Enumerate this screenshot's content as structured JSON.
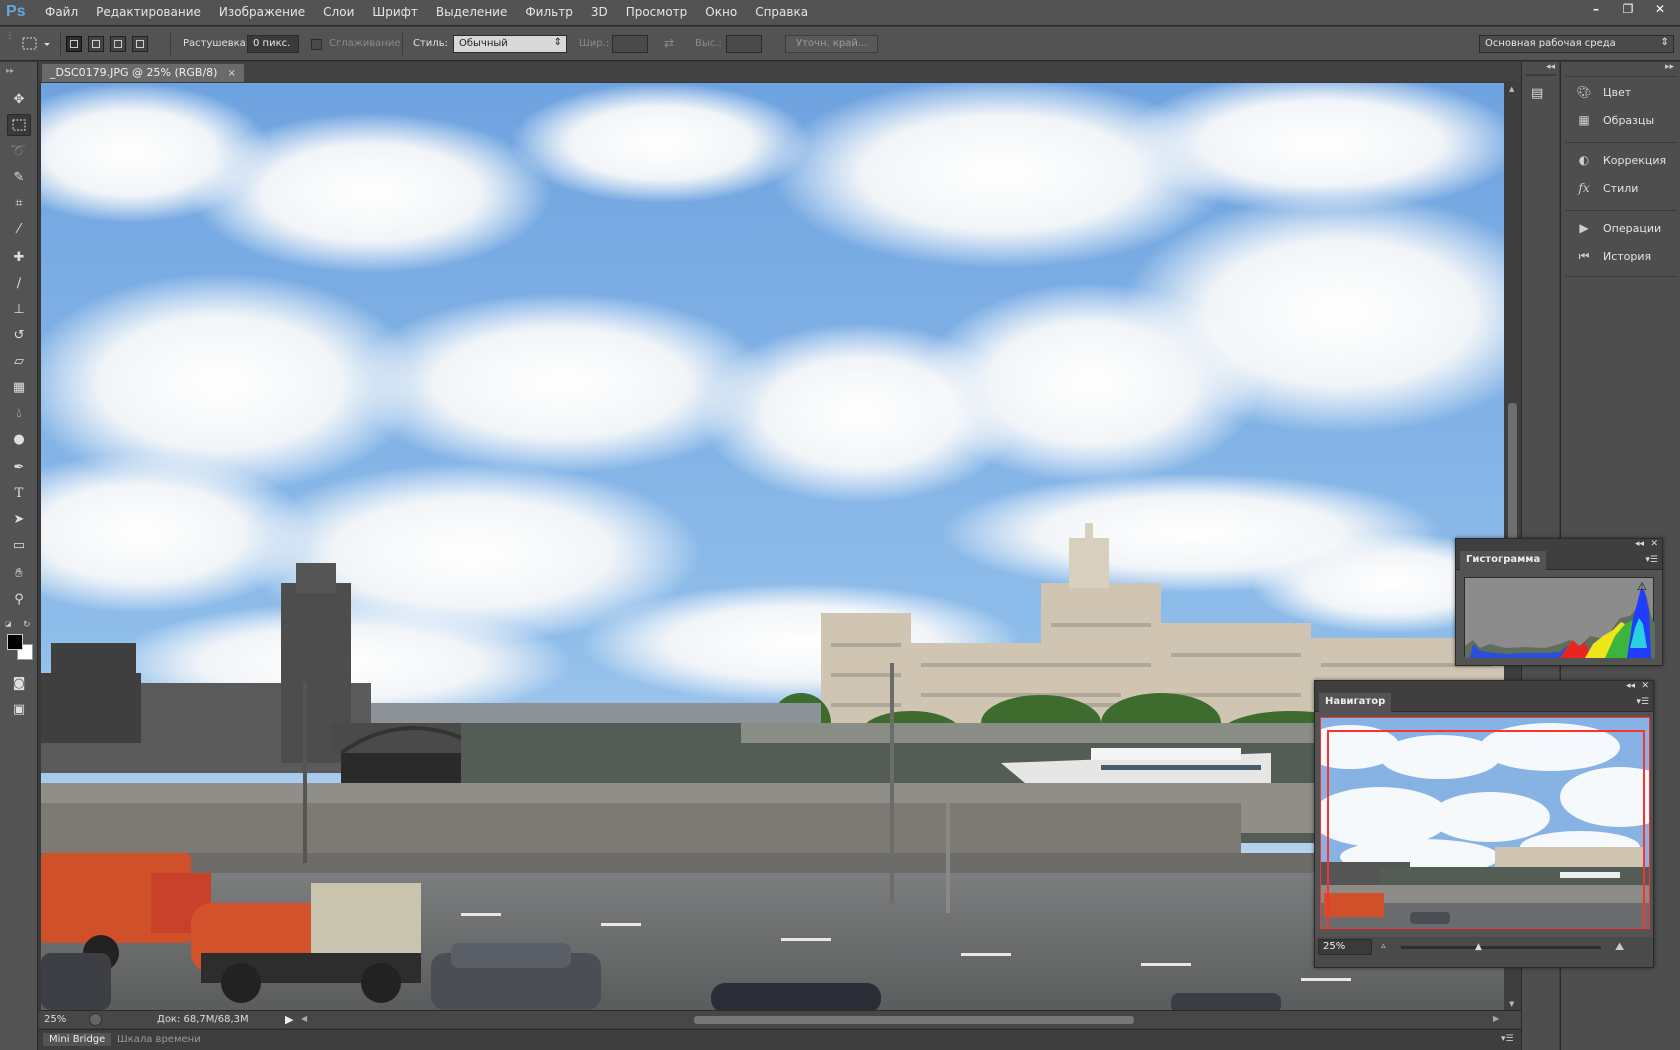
{
  "app": {
    "logo": "Ps"
  },
  "menu": [
    "Файл",
    "Редактирование",
    "Изображение",
    "Слои",
    "Шрифт",
    "Выделение",
    "Фильтр",
    "3D",
    "Просмотр",
    "Окно",
    "Справка"
  ],
  "window_controls": {
    "minimize": "–",
    "restore": "❐",
    "close": "✕"
  },
  "options": {
    "feather_label": "Растушевка:",
    "feather_value": "0 пикс.",
    "antialias_label": "Сглаживание",
    "style_label": "Стиль:",
    "style_value": "Обычный",
    "width_label": "Шир.:",
    "height_label": "Выс.:",
    "refine_edge": "Уточн. край...",
    "workspace": "Основная рабочая среда"
  },
  "document": {
    "tab_title": "_DSC0179.JPG @ 25% (RGB/8)",
    "close": "×",
    "zoom": "25%",
    "doc_info": "Док: 68,7M/68,3M"
  },
  "bottom_tabs": [
    "Mini Bridge",
    "Шкала времени"
  ],
  "dock": {
    "groups": [
      [
        {
          "label": "Цвет",
          "icon": "palette-icon"
        },
        {
          "label": "Образцы",
          "icon": "swatches-icon"
        }
      ],
      [
        {
          "label": "Коррекция",
          "icon": "adjustments-icon"
        },
        {
          "label": "Стили",
          "icon": "fx-styles-icon"
        }
      ],
      [
        {
          "label": "Операции",
          "icon": "play-actions-icon"
        },
        {
          "label": "История",
          "icon": "history-icon"
        }
      ]
    ]
  },
  "histogram": {
    "title": "Гистограмма"
  },
  "navigator": {
    "title": "Навигатор",
    "zoom": "25%"
  },
  "colors": {
    "ps_blue": "#5fa8e0",
    "panel_bg": "#535353",
    "nav_frame": "#ff3030"
  }
}
